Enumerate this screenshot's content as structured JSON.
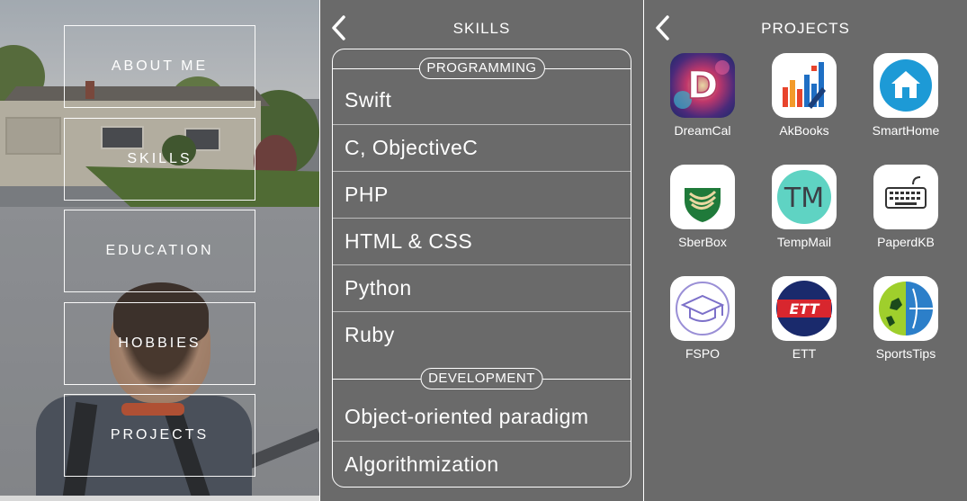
{
  "menu": {
    "items": [
      {
        "label": "ABOUT ME"
      },
      {
        "label": "SKILLS"
      },
      {
        "label": "EDUCATION"
      },
      {
        "label": "HOBBIES"
      },
      {
        "label": "PROJECTS"
      }
    ]
  },
  "skills": {
    "title": "SKILLS",
    "sections": [
      {
        "label": "PROGRAMMING",
        "items": [
          "Swift",
          "C, ObjectiveC",
          "PHP",
          "HTML & CSS",
          "Python",
          "Ruby"
        ]
      },
      {
        "label": "DEVELOPMENT",
        "items": [
          "Object-oriented paradigm",
          "Algorithmization"
        ]
      }
    ]
  },
  "projects": {
    "title": "PROJECTS",
    "items": [
      {
        "name": "DreamCal",
        "icon": "dreamcal-icon"
      },
      {
        "name": "AkBooks",
        "icon": "akbooks-icon"
      },
      {
        "name": "SmartHome",
        "icon": "smarthome-icon"
      },
      {
        "name": "SberBox",
        "icon": "sberbox-icon"
      },
      {
        "name": "TempMail",
        "icon": "tempmail-icon"
      },
      {
        "name": "PaperdKB",
        "icon": "paperdkb-icon"
      },
      {
        "name": "FSPO",
        "icon": "fspo-icon"
      },
      {
        "name": "ETT",
        "icon": "ett-icon"
      },
      {
        "name": "SportsTips",
        "icon": "sportstips-icon"
      }
    ]
  },
  "ett_logo_text": "ETT",
  "tempmail_logo_text": "TM",
  "dreamcal_logo_text": "D",
  "colors": {
    "panel_bg": "#6a6a6a",
    "smarthome_blue": "#1d9ad6",
    "tempmail_teal": "#5fd3c3",
    "sber_green": "#1f7a3a"
  }
}
